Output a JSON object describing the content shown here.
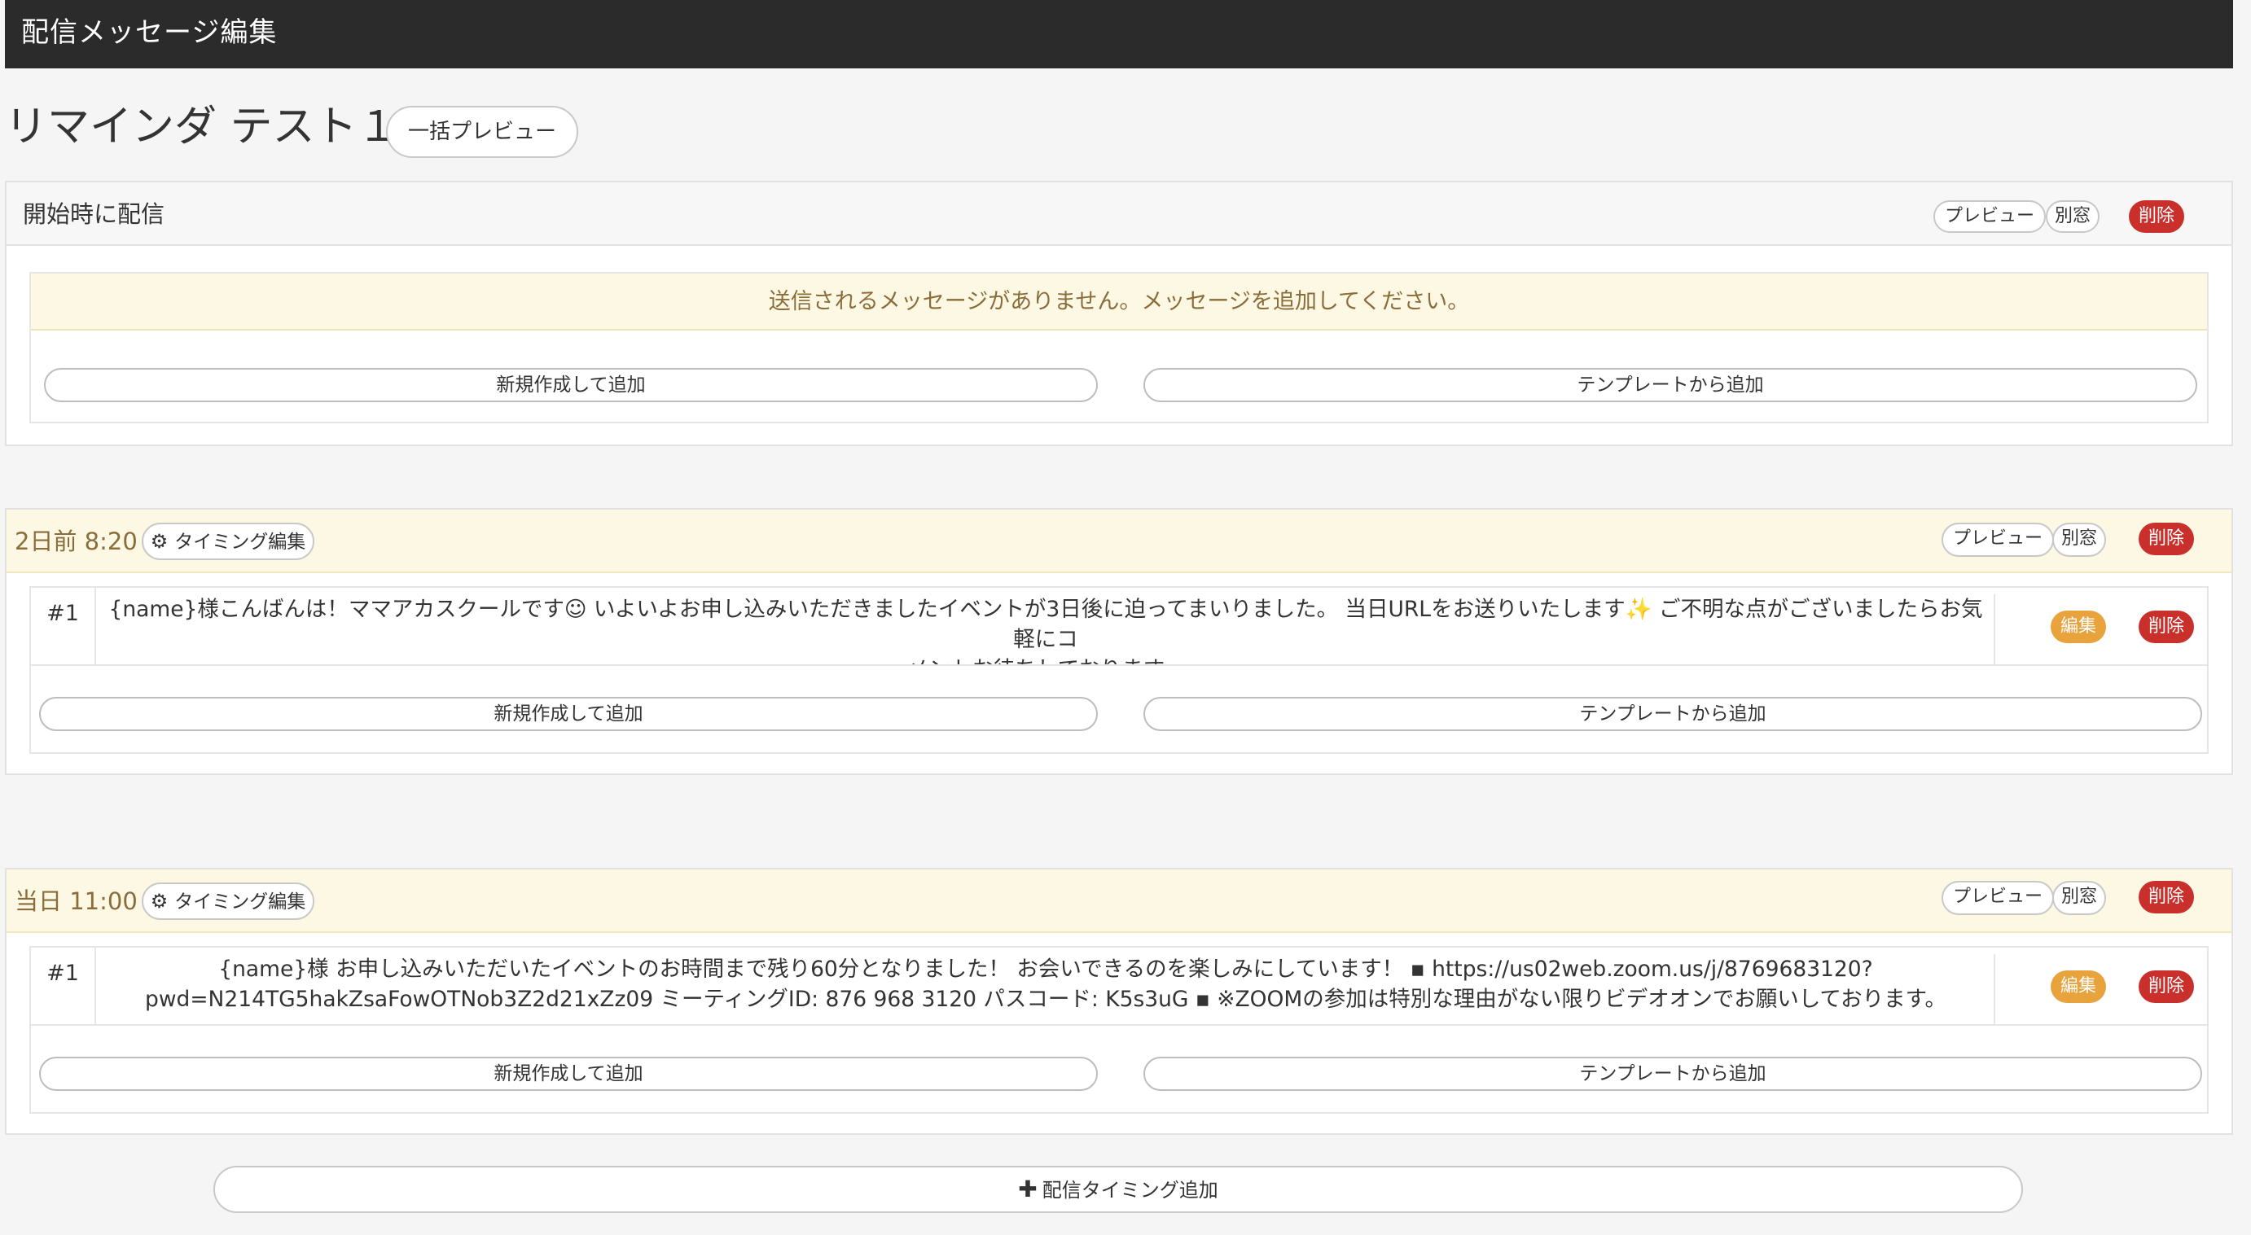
{
  "window": {
    "title": "配信メッセージ編集"
  },
  "page": {
    "title": "リマインダ テスト１",
    "bulk_preview_label": "一括プレビュー"
  },
  "common": {
    "preview_label": "プレビュー",
    "new_window_label": "別窓",
    "delete_label": "削除",
    "edit_label": "編集",
    "timing_edit_label": "タイミング編集",
    "add_new_label": "新規作成して追加",
    "add_template_label": "テンプレートから追加"
  },
  "sections": [
    {
      "title": "開始時に配信",
      "empty_notice": "送信されるメッセージがありません。メッセージを追加してください。"
    },
    {
      "title": "2日前 8:20",
      "messages": [
        {
          "num": "#1",
          "line1": "{name}様こんばんは！ママアカスクールです☺ いよいよお申し込みいただきましたイベントが3日後に迫ってまいりました。 当日URLをお送りいたします✨ ご不明な点がございましたらお気軽にコ",
          "line2": "メントお待ちしております。"
        }
      ]
    },
    {
      "title": "当日 11:00",
      "messages": [
        {
          "num": "#1",
          "line1": "{name}様 お申し込みいただいたイベントのお時間まで残り60分となりました！ お会いできるのを楽しみにしています！ ▪ https://us02web.zoom.us/j/8769683120?",
          "line2": "pwd=N214TG5hakZsaFowOTNob3Z2d21xZz09 ミーティングID: 876 968 3120 パスコード: K5s3uG ▪ ※ZOOMの参加は特別な理由がない限りビデオオンでお願いしております。"
        }
      ]
    }
  ],
  "footer": {
    "add_timing_label": "配信タイミング追加"
  },
  "colors": {
    "topbar": "#2b2b2b",
    "delete": "#c9302c",
    "edit": "#e8a33d",
    "notice_bg": "#fcf8e3",
    "notice_text": "#8a6d3b"
  }
}
